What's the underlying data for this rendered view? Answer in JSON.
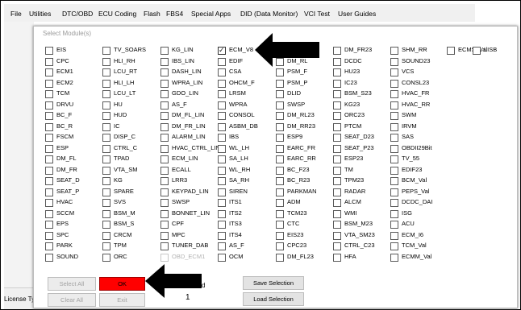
{
  "menu": [
    "File",
    "Utilities",
    "DTC/OBD",
    "ECU Coding",
    "Flash",
    "FBS4",
    "Special Apps",
    "DID (Data Monitor)",
    "VCI Test",
    "User Guides"
  ],
  "dialog": {
    "title": "Select Module(s)"
  },
  "modules": [
    [
      {
        "label": "EIS",
        "checked": false,
        "disabled": false
      },
      {
        "label": "CPC",
        "checked": false,
        "disabled": false
      },
      {
        "label": "ECM1",
        "checked": false,
        "disabled": false
      },
      {
        "label": "ECM2",
        "checked": false,
        "disabled": false
      },
      {
        "label": "TCM",
        "checked": false,
        "disabled": false
      },
      {
        "label": "DRVU",
        "checked": false,
        "disabled": false
      },
      {
        "label": "BC_F",
        "checked": false,
        "disabled": false
      },
      {
        "label": "BC_R",
        "checked": false,
        "disabled": false
      },
      {
        "label": "FSCM",
        "checked": false,
        "disabled": false
      },
      {
        "label": "ESP",
        "checked": false,
        "disabled": false
      },
      {
        "label": "DM_FL",
        "checked": false,
        "disabled": false
      },
      {
        "label": "DM_FR",
        "checked": false,
        "disabled": false
      },
      {
        "label": "SEAT_D",
        "checked": false,
        "disabled": false
      },
      {
        "label": "SEAT_P",
        "checked": false,
        "disabled": false
      },
      {
        "label": "HVAC",
        "checked": false,
        "disabled": false
      },
      {
        "label": "SCCM",
        "checked": false,
        "disabled": false
      },
      {
        "label": "EPS",
        "checked": false,
        "disabled": false
      },
      {
        "label": "SPC",
        "checked": false,
        "disabled": false
      },
      {
        "label": "PARK",
        "checked": false,
        "disabled": false
      },
      {
        "label": "SOUND",
        "checked": false,
        "disabled": false
      }
    ],
    [
      {
        "label": "TV_SOARS",
        "checked": false,
        "disabled": false
      },
      {
        "label": "HLI_RH",
        "checked": false,
        "disabled": false
      },
      {
        "label": "LCU_RT",
        "checked": false,
        "disabled": false
      },
      {
        "label": "HLI_LH",
        "checked": false,
        "disabled": false
      },
      {
        "label": "LCU_LT",
        "checked": false,
        "disabled": false
      },
      {
        "label": "HU",
        "checked": false,
        "disabled": false
      },
      {
        "label": "HUD",
        "checked": false,
        "disabled": false
      },
      {
        "label": "IC",
        "checked": false,
        "disabled": false
      },
      {
        "label": "DISP_C",
        "checked": false,
        "disabled": false
      },
      {
        "label": "CTRL_C",
        "checked": false,
        "disabled": false
      },
      {
        "label": "TPAD",
        "checked": false,
        "disabled": false
      },
      {
        "label": "VTA_SM",
        "checked": false,
        "disabled": false
      },
      {
        "label": "KG",
        "checked": false,
        "disabled": false
      },
      {
        "label": "SPARE",
        "checked": false,
        "disabled": false
      },
      {
        "label": "SVS",
        "checked": false,
        "disabled": false
      },
      {
        "label": "BSM_M",
        "checked": false,
        "disabled": false
      },
      {
        "label": "BSM_S",
        "checked": false,
        "disabled": false
      },
      {
        "label": "CRCM",
        "checked": false,
        "disabled": false
      },
      {
        "label": "TPM",
        "checked": false,
        "disabled": false
      },
      {
        "label": "ORC",
        "checked": false,
        "disabled": false
      }
    ],
    [
      {
        "label": "KG_LIN",
        "checked": false,
        "disabled": false
      },
      {
        "label": "IBS_LIN",
        "checked": false,
        "disabled": false
      },
      {
        "label": "DASH_LIN",
        "checked": false,
        "disabled": false
      },
      {
        "label": "WPRA_LIN",
        "checked": false,
        "disabled": false
      },
      {
        "label": "GDO_LIN",
        "checked": false,
        "disabled": false
      },
      {
        "label": "AS_F",
        "checked": false,
        "disabled": false
      },
      {
        "label": "DM_FL_LIN",
        "checked": false,
        "disabled": false
      },
      {
        "label": "DM_FR_LIN",
        "checked": false,
        "disabled": false
      },
      {
        "label": "ALARM_LIN",
        "checked": false,
        "disabled": false
      },
      {
        "label": "HVAC_CTRL_LIN",
        "checked": false,
        "disabled": false
      },
      {
        "label": "ECM_LIN",
        "checked": false,
        "disabled": false
      },
      {
        "label": "ECALL",
        "checked": false,
        "disabled": false
      },
      {
        "label": "LRR3",
        "checked": false,
        "disabled": false
      },
      {
        "label": "KEYPAD_LIN",
        "checked": false,
        "disabled": false
      },
      {
        "label": "SWSP",
        "checked": false,
        "disabled": false
      },
      {
        "label": "BONNET_LIN",
        "checked": false,
        "disabled": false
      },
      {
        "label": "CPF",
        "checked": false,
        "disabled": false
      },
      {
        "label": "MPC",
        "checked": false,
        "disabled": false
      },
      {
        "label": "TUNER_DAB",
        "checked": false,
        "disabled": false
      },
      {
        "label": "OBD_ECM1",
        "checked": false,
        "disabled": true
      }
    ],
    [
      {
        "label": "ECM_V8",
        "checked": true,
        "disabled": false
      },
      {
        "label": "EDIF",
        "checked": false,
        "disabled": false
      },
      {
        "label": "CSA",
        "checked": false,
        "disabled": false
      },
      {
        "label": "OHCM_F",
        "checked": false,
        "disabled": false
      },
      {
        "label": "LRSM",
        "checked": false,
        "disabled": false
      },
      {
        "label": "WPRA",
        "checked": false,
        "disabled": false
      },
      {
        "label": "CONSOL",
        "checked": false,
        "disabled": false
      },
      {
        "label": "ASBM_DB",
        "checked": false,
        "disabled": false
      },
      {
        "label": "IBS",
        "checked": false,
        "disabled": false
      },
      {
        "label": "WL_LH",
        "checked": false,
        "disabled": false
      },
      {
        "label": "SA_LH",
        "checked": false,
        "disabled": false
      },
      {
        "label": "WL_RH",
        "checked": false,
        "disabled": false
      },
      {
        "label": "SA_RH",
        "checked": false,
        "disabled": false
      },
      {
        "label": "SIREN",
        "checked": false,
        "disabled": false
      },
      {
        "label": "ITS1",
        "checked": false,
        "disabled": false
      },
      {
        "label": "ITS2",
        "checked": false,
        "disabled": false
      },
      {
        "label": "ITS3",
        "checked": false,
        "disabled": false
      },
      {
        "label": "ITS4",
        "checked": false,
        "disabled": false
      },
      {
        "label": "AS_F",
        "checked": false,
        "disabled": false
      },
      {
        "label": "OCM",
        "checked": false,
        "disabled": false
      }
    ],
    [
      {
        "label": "DM_RR",
        "checked": false,
        "disabled": false
      },
      {
        "label": "DM_RL",
        "checked": false,
        "disabled": false
      },
      {
        "label": "PSM_F",
        "checked": false,
        "disabled": false
      },
      {
        "label": "PSM_P",
        "checked": false,
        "disabled": false
      },
      {
        "label": "DLID",
        "checked": false,
        "disabled": false
      },
      {
        "label": "SWSP",
        "checked": false,
        "disabled": false
      },
      {
        "label": "DM_RL23",
        "checked": false,
        "disabled": false
      },
      {
        "label": "DM_RR23",
        "checked": false,
        "disabled": false
      },
      {
        "label": "ESP9",
        "checked": false,
        "disabled": false
      },
      {
        "label": "EARC_FR",
        "checked": false,
        "disabled": false
      },
      {
        "label": "EARC_RR",
        "checked": false,
        "disabled": false
      },
      {
        "label": "BC_F23",
        "checked": false,
        "disabled": false
      },
      {
        "label": "BC_R23",
        "checked": false,
        "disabled": false
      },
      {
        "label": "PARKMAN",
        "checked": false,
        "disabled": false
      },
      {
        "label": "ADM",
        "checked": false,
        "disabled": false
      },
      {
        "label": "TCM23",
        "checked": false,
        "disabled": false
      },
      {
        "label": "CTC",
        "checked": false,
        "disabled": false
      },
      {
        "label": "EIS23",
        "checked": false,
        "disabled": false
      },
      {
        "label": "CPC23",
        "checked": false,
        "disabled": false
      },
      {
        "label": "DM_FL23",
        "checked": false,
        "disabled": false
      }
    ],
    [
      {
        "label": "DM_FR23",
        "checked": false,
        "disabled": false
      },
      {
        "label": "DCDC",
        "checked": false,
        "disabled": false
      },
      {
        "label": "HU23",
        "checked": false,
        "disabled": false
      },
      {
        "label": "IC23",
        "checked": false,
        "disabled": false
      },
      {
        "label": "BSM_S23",
        "checked": false,
        "disabled": false
      },
      {
        "label": "KG23",
        "checked": false,
        "disabled": false
      },
      {
        "label": "ORC23",
        "checked": false,
        "disabled": false
      },
      {
        "label": "PTCM",
        "checked": false,
        "disabled": false
      },
      {
        "label": "SEAT_D23",
        "checked": false,
        "disabled": false
      },
      {
        "label": "SEAT_P23",
        "checked": false,
        "disabled": false
      },
      {
        "label": "ESP23",
        "checked": false,
        "disabled": false
      },
      {
        "label": "TM",
        "checked": false,
        "disabled": false
      },
      {
        "label": "TPM23",
        "checked": false,
        "disabled": false
      },
      {
        "label": "RADAR",
        "checked": false,
        "disabled": false
      },
      {
        "label": "ALCM",
        "checked": false,
        "disabled": false
      },
      {
        "label": "WMI",
        "checked": false,
        "disabled": false
      },
      {
        "label": "BSM_M23",
        "checked": false,
        "disabled": false
      },
      {
        "label": "VTA_SM23",
        "checked": false,
        "disabled": false
      },
      {
        "label": "CTRL_C23",
        "checked": false,
        "disabled": false
      },
      {
        "label": "HFA",
        "checked": false,
        "disabled": false
      }
    ],
    [
      {
        "label": "SHM_RR",
        "checked": false,
        "disabled": false
      },
      {
        "label": "SOUND23",
        "checked": false,
        "disabled": false
      },
      {
        "label": "VCS",
        "checked": false,
        "disabled": false
      },
      {
        "label": "CONSL23",
        "checked": false,
        "disabled": false
      },
      {
        "label": "HVAC_FR",
        "checked": false,
        "disabled": false
      },
      {
        "label": "HVAC_RR",
        "checked": false,
        "disabled": false
      },
      {
        "label": "SWM",
        "checked": false,
        "disabled": false
      },
      {
        "label": "IRVM",
        "checked": false,
        "disabled": false
      },
      {
        "label": "SAS",
        "checked": false,
        "disabled": false
      },
      {
        "label": "OBDII29Bit",
        "checked": false,
        "disabled": false
      },
      {
        "label": "TV_55",
        "checked": false,
        "disabled": false
      },
      {
        "label": "EDIF23",
        "checked": false,
        "disabled": false
      },
      {
        "label": "BCM_Val",
        "checked": false,
        "disabled": false
      },
      {
        "label": "PEPS_Val",
        "checked": false,
        "disabled": false
      },
      {
        "label": "DCDC_DAI",
        "checked": false,
        "disabled": false
      },
      {
        "label": "ISG",
        "checked": false,
        "disabled": false
      },
      {
        "label": "ACU",
        "checked": false,
        "disabled": false
      },
      {
        "label": "ECM_I6",
        "checked": false,
        "disabled": false
      },
      {
        "label": "TCM_Val",
        "checked": false,
        "disabled": false
      },
      {
        "label": "ECMM_Val",
        "checked": false,
        "disabled": false
      }
    ],
    [
      {
        "label": "ECMS_Val",
        "checked": false,
        "disabled": false
      }
    ],
    [
      {
        "label": "LISB",
        "checked": false,
        "disabled": false
      }
    ]
  ],
  "buttons": {
    "select_all": "Select All",
    "ok": "OK",
    "clear_all": "Clear All",
    "exit": "Exit",
    "save_selection": "Save Selection",
    "load_selection": "Load Selection"
  },
  "selected_suffix": "d",
  "selected_count": "1",
  "status": {
    "license": "License Ty"
  },
  "colors": {
    "ok_button": "#ff0000",
    "arrow": "#000000"
  }
}
